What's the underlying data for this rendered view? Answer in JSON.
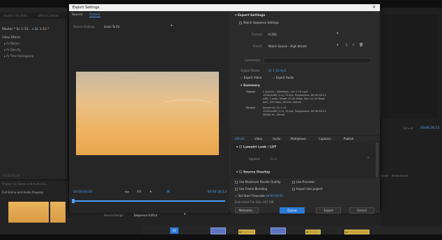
{
  "dialog": {
    "title": "Export Settings",
    "close_glyph": "✕"
  },
  "background": {
    "panel_tabs": [
      "Source: Vid_0001",
      "Effect Controls"
    ],
    "clip_label": "Master * Sc 1-15...",
    "clip_sequence": "Sc 1-15 *",
    "effects_header": "Video Effects",
    "effects": [
      "Motion",
      "Opacity",
      "Time Remapping"
    ],
    "timecode": "00;00;00;00",
    "project_title": "Project: Sc Scene and Audio Fe...",
    "project_item": "Full Scene and Audio Pauping",
    "right_timecode": "00;06;36;13",
    "right_ruler": [
      "00:00",
      "00:00:00:00"
    ],
    "track_label": "A2",
    "clip_markers": [
      "fx",
      "fx",
      "fx",
      "fx"
    ]
  },
  "source_panel": {
    "tabs": [
      {
        "label": "Source",
        "active": false
      },
      {
        "label": "Output",
        "active": true
      }
    ],
    "scaling_label": "Source Scaling:",
    "scaling_value": "Scale To Fit",
    "timecode_start": "00:00:00:00",
    "timecode_end": "00:00:36:13",
    "step_glyph": "◂ ▸",
    "fit_value": "Fit",
    "source_range_label": "Source Range:",
    "source_range_value": "Sequence In/Out",
    "progress": 0.02
  },
  "export_settings": {
    "section_title": "Export Settings",
    "match_sequence": "Match Sequence Settings",
    "format_label": "Format:",
    "format_value": "H.264",
    "preset_label": "Preset:",
    "preset_value": "Match Source - High bitrate",
    "comments_label": "Comments:",
    "output_name_label": "Output Name:",
    "output_name_value": "Sc 1-15.mp4",
    "export_video": "Export Video",
    "export_audio": "Export Audio",
    "summary_title": "Summary",
    "summary_output_label": "Output:",
    "summary_output_lines": [
      "C:\\Users\\...\\Desktop\\...\\Sc 1-15.mp4",
      "1920x1080 (1.0), 25 fps, Progressive, 00:00:36:13",
      "VBR, 1 pass, Target 10.00 Mbps, Max 12.00 Mbps",
      "AAC, 320 kbps, 48 kHz, Stereo"
    ],
    "summary_source_label": "Source:",
    "summary_source_lines": [
      "Sequence, Sc 1-15",
      "1920x1080 (1.0), 25 fps, Progressive, 00:06:36:13",
      "48000 Hz, Stereo"
    ]
  },
  "settings_tabs": [
    {
      "label": "Effects",
      "active": true
    },
    {
      "label": "Video",
      "active": false
    },
    {
      "label": "Audio",
      "active": false
    },
    {
      "label": "Multiplexer",
      "active": false
    },
    {
      "label": "Captions",
      "active": false
    },
    {
      "label": "Publish",
      "active": false
    }
  ],
  "effects_panel": {
    "lumetri_title": "Lumetri Look / LUT",
    "applied_label": "Applied:",
    "applied_value": "None",
    "next_section": "Source Overlay"
  },
  "options": {
    "max_render_quality": "Use Maximum Render Quality",
    "use_previews": "Use Previews",
    "frame_blending": "Use Frame Blending",
    "import_into_project": "Import into project",
    "set_start_timecode": "Set Start Timecode",
    "start_timecode_value": "00:00:00:00",
    "file_size_label": "Estimated File Size:",
    "file_size_value": "467 MB"
  },
  "buttons": {
    "metadata": "Metadata...",
    "queue": "Queue",
    "export": "Export",
    "cancel": "Cancel"
  },
  "colors": {
    "accent": "#4c9df3",
    "primary_button": "#2e7bd7"
  }
}
